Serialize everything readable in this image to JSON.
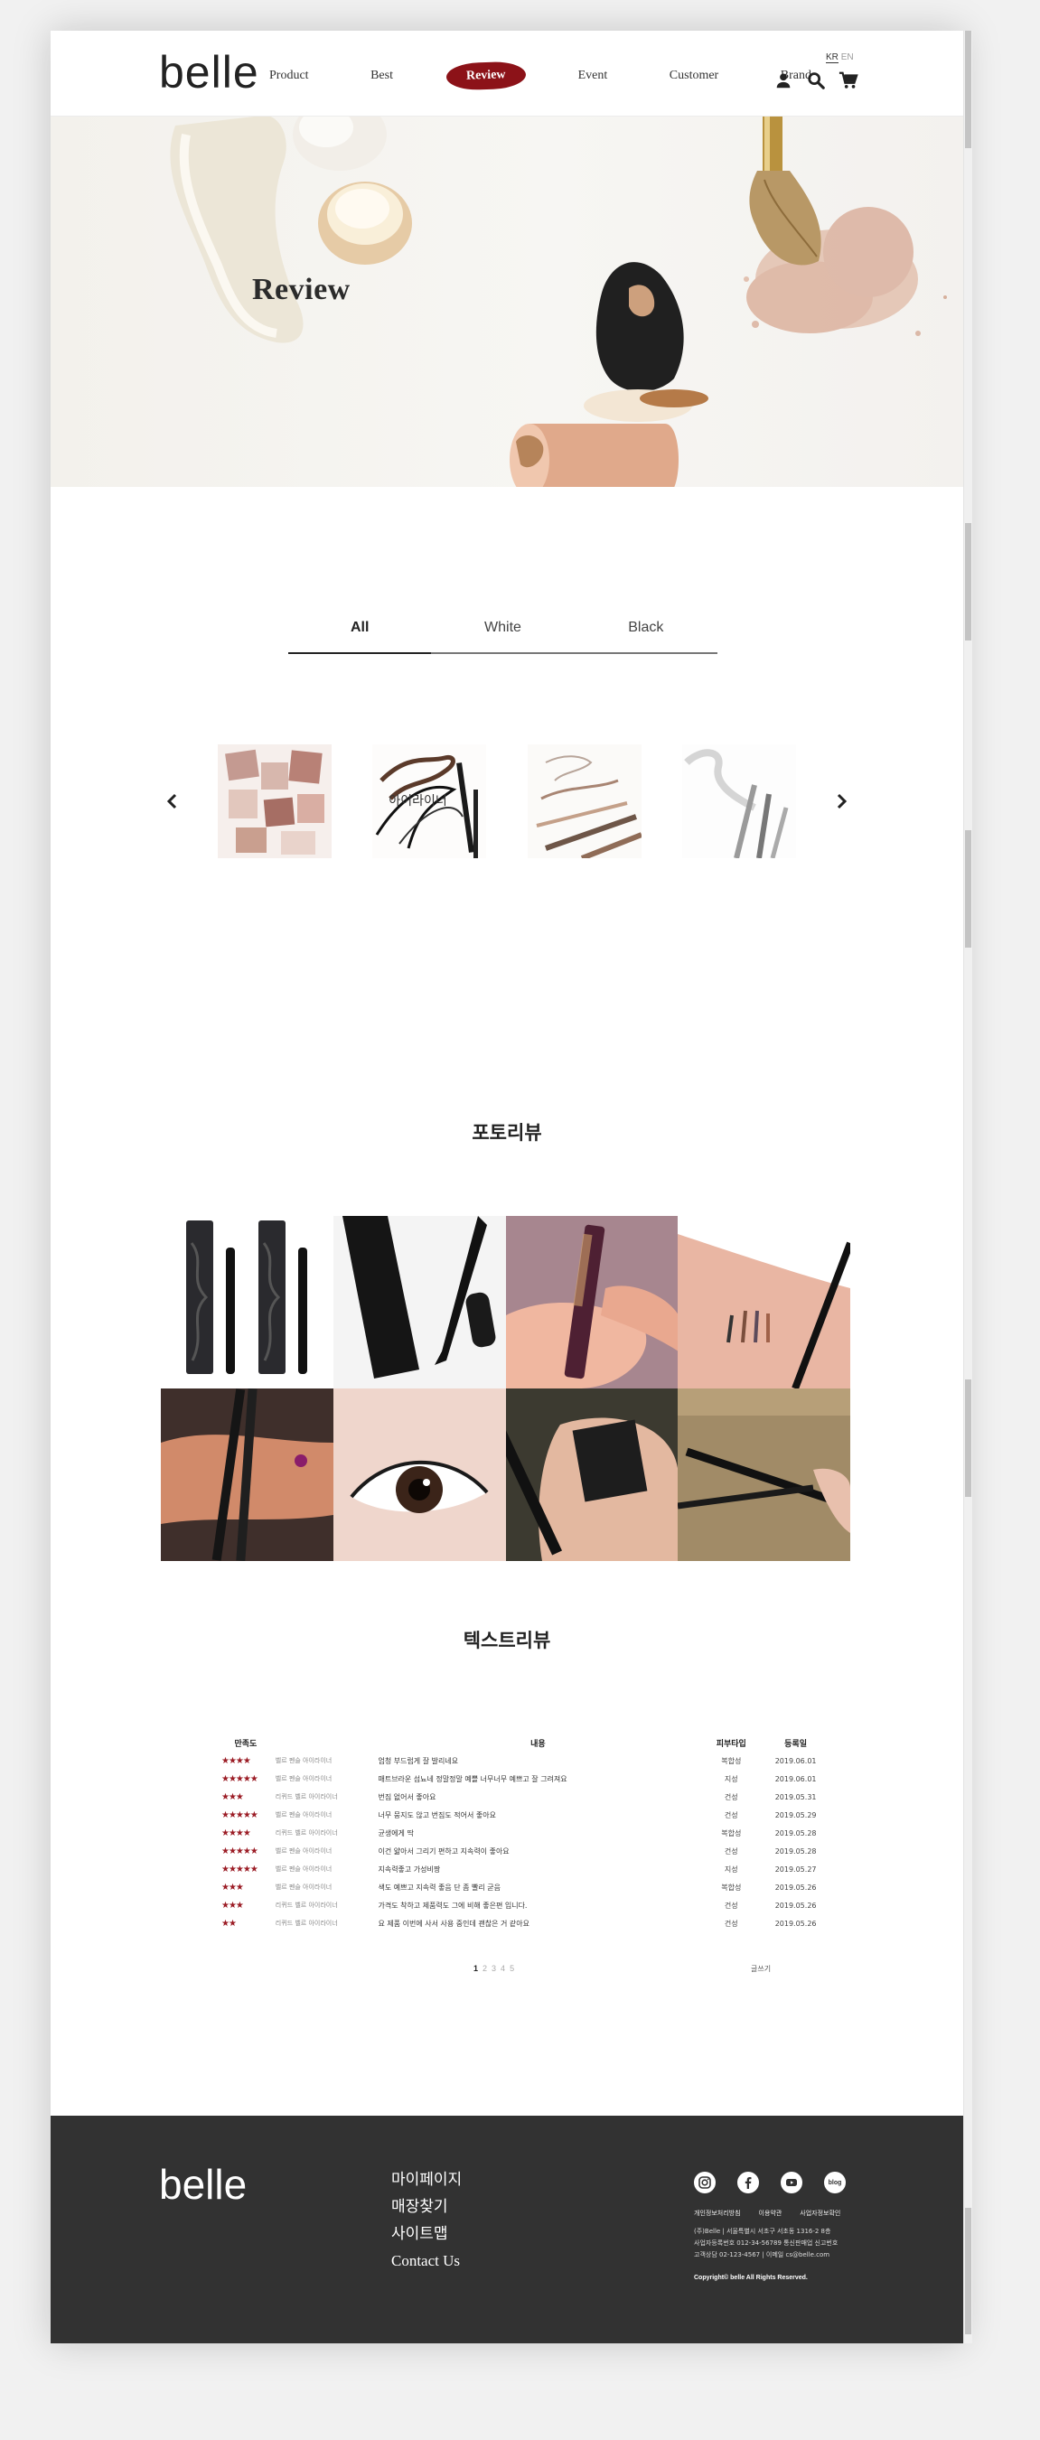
{
  "header": {
    "logo": "belle",
    "nav": [
      {
        "label": "Product"
      },
      {
        "label": "Best"
      },
      {
        "label": "Review",
        "active": true
      },
      {
        "label": "Event"
      },
      {
        "label": "Customer"
      },
      {
        "label": "Brand"
      }
    ],
    "lang": {
      "kr": "KR",
      "en": "EN"
    },
    "icons": [
      "user-icon",
      "search-icon",
      "cart-icon"
    ]
  },
  "hero": {
    "title": "Review"
  },
  "tabs": [
    {
      "label": "All",
      "active": true
    },
    {
      "label": "White"
    },
    {
      "label": "Black"
    }
  ],
  "slider": {
    "hover_label": "아이라이너",
    "items": [
      "eyeshadow-palette",
      "eyeliner",
      "eyebrow-pencil",
      "mascara"
    ]
  },
  "photo_review": {
    "title": "포토리뷰",
    "photos": [
      "eyeliner-packages",
      "eyeliner-pen-box",
      "kill-brown-liner",
      "arm-swatch",
      "hand-liners",
      "eye-closeup",
      "liner-box-in-hand",
      "liner-pencils-on-wood"
    ]
  },
  "text_review": {
    "title": "텍스트리뷰",
    "columns": {
      "rating": "만족도",
      "content": "내용",
      "skin": "피부타입",
      "date": "등록일"
    },
    "rows": [
      {
        "stars": "★★★★",
        "product": "벨르 펜슬 아이라이너",
        "content": "엄청 부드럽게 잘 발리네요",
        "skin": "복합성",
        "date": "2019.06.01"
      },
      {
        "stars": "★★★★★",
        "product": "벨르 펜슬 아이라이너",
        "content": "매트브라운 섬뇨네 정말정말 예쁠 너무너무 예쁘고 잘 그려져요",
        "skin": "지성",
        "date": "2019.06.01"
      },
      {
        "stars": "★★★",
        "product": "리퀴드 벨르 아이라이너",
        "content": "번짐 없어서 좋아요",
        "skin": "건성",
        "date": "2019.05.31"
      },
      {
        "stars": "★★★★★",
        "product": "벨르 펜슬 아이라이너",
        "content": "너무 뭉지도 않고 번짐도 적어서 좋아요",
        "skin": "건성",
        "date": "2019.05.29"
      },
      {
        "stars": "★★★★",
        "product": "리퀴드 벨르 아이라이너",
        "content": "균생에게 딱",
        "skin": "복합성",
        "date": "2019.05.28"
      },
      {
        "stars": "★★★★★",
        "product": "벨르 펜슬 아이라이너",
        "content": "이건 얇아서 그리기 편하고 지속력이 좋아요",
        "skin": "건성",
        "date": "2019.05.28"
      },
      {
        "stars": "★★★★★",
        "product": "벨르 펜슬 아이라이너",
        "content": "지속력좋고 가성비짱",
        "skin": "지성",
        "date": "2019.05.27"
      },
      {
        "stars": "★★★",
        "product": "벨르 펜슬 아이라이너",
        "content": "색도 예쁘고 지속력 좋음 단 좀 빨리 굳음",
        "skin": "복합성",
        "date": "2019.05.26"
      },
      {
        "stars": "★★★",
        "product": "리퀴드 벨르 아이라이너",
        "content": "가격도 착하고 제품력도 그에 비해 좋은편 입니다.",
        "skin": "건성",
        "date": "2019.05.26"
      },
      {
        "stars": "★★",
        "product": "리퀴드 벨르 아이라이너",
        "content": "요 제품 이번에 사서 사용 중인데 괜찮은 거 같아요",
        "skin": "건성",
        "date": "2019.05.26"
      }
    ],
    "pages": [
      "1",
      "2",
      "3",
      "4",
      "5"
    ],
    "write_label": "글쓰기"
  },
  "footer": {
    "logo": "belle",
    "links": [
      "마이페이지",
      "매장찾기",
      "사이트맵",
      "Contact Us"
    ],
    "social": [
      "instagram-icon",
      "facebook-icon",
      "youtube-icon",
      "blog-icon"
    ],
    "blog_label": "blog",
    "policy": [
      "개인정보처리방침",
      "이용약관",
      "사업자정보확인"
    ],
    "company_lines": [
      "(주)Belle   |   서울특별시 서초구 서초동 1316-2 8층",
      "사업자등록번호 012-34-56789   통신판매업 신고번호",
      "고객상담 02-123-4567   |   이메일 cs@belle.com"
    ],
    "copyright": "Copyright© belle All Rights Reserved."
  }
}
